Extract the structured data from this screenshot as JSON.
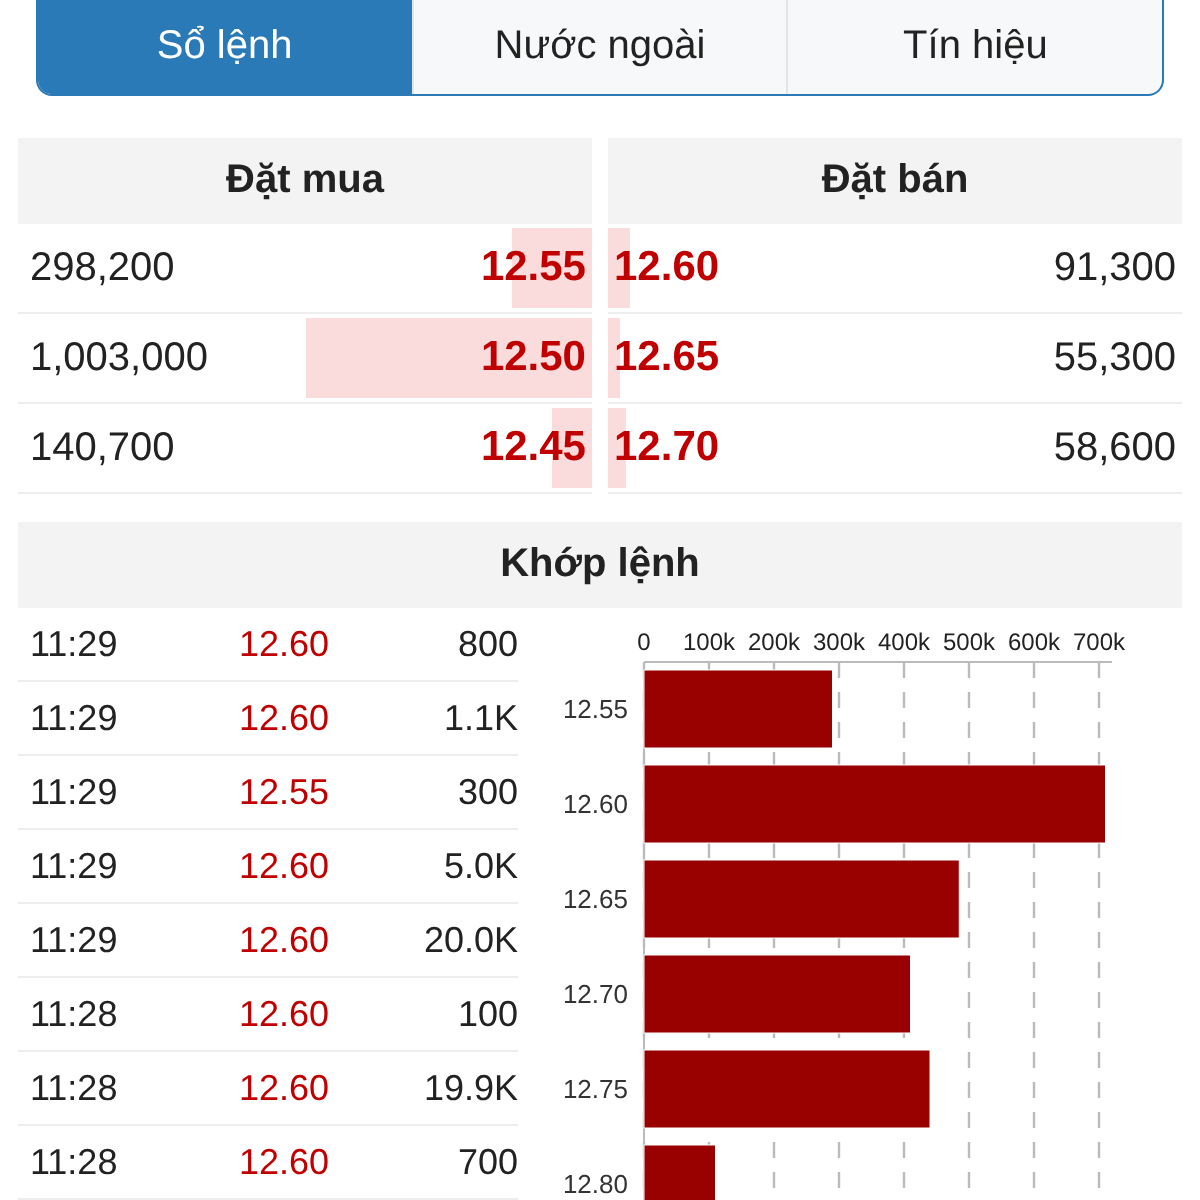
{
  "tabs": [
    {
      "label": "Sổ lệnh",
      "selected": true
    },
    {
      "label": "Nước ngoài",
      "selected": false
    },
    {
      "label": "Tín hiệu",
      "selected": false
    }
  ],
  "order_book": {
    "bid_header": "Đặt mua",
    "ask_header": "Đặt bán",
    "rows": [
      {
        "bid": {
          "volume": "298,200",
          "price": "12.55",
          "level": 0.14
        },
        "ask": {
          "price": "12.60",
          "level": 0.04,
          "volume": "91,300"
        }
      },
      {
        "bid": {
          "volume": "1,003,000",
          "price": "12.50",
          "level": 0.5
        },
        "ask": {
          "price": "12.65",
          "level": 0.02,
          "volume": "55,300"
        }
      },
      {
        "bid": {
          "volume": "140,700",
          "price": "12.45",
          "level": 0.07
        },
        "ask": {
          "price": "12.70",
          "level": 0.03,
          "volume": "58,600"
        }
      }
    ]
  },
  "matches": {
    "title": "Khớp lệnh",
    "rows": [
      {
        "time": "11:29",
        "price": "12.60",
        "volume": "800"
      },
      {
        "time": "11:29",
        "price": "12.60",
        "volume": "1.1K"
      },
      {
        "time": "11:29",
        "price": "12.55",
        "volume": "300"
      },
      {
        "time": "11:29",
        "price": "12.60",
        "volume": "5.0K"
      },
      {
        "time": "11:29",
        "price": "12.60",
        "volume": "20.0K"
      },
      {
        "time": "11:28",
        "price": "12.60",
        "volume": "100"
      },
      {
        "time": "11:28",
        "price": "12.60",
        "volume": "19.9K"
      },
      {
        "time": "11:28",
        "price": "12.60",
        "volume": "700"
      }
    ],
    "chart_data": {
      "type": "bar",
      "orientation": "horizontal",
      "grid": true,
      "categories": [
        "12.55",
        "12.60",
        "12.65",
        "12.70",
        "12.75",
        "12.80"
      ],
      "series": [
        {
          "color": "#990000",
          "values": [
            290000,
            710000,
            485000,
            410000,
            440000,
            110000
          ]
        }
      ],
      "xlim": [
        0,
        720000
      ],
      "xticks": [
        {
          "value": 0,
          "label": "0"
        },
        {
          "value": 100000,
          "label": "100k"
        },
        {
          "value": 200000,
          "label": "200k"
        },
        {
          "value": 300000,
          "label": "300k"
        },
        {
          "value": 400000,
          "label": "400k"
        },
        {
          "value": 500000,
          "label": "500k"
        },
        {
          "value": 600000,
          "label": "600k"
        },
        {
          "value": 700000,
          "label": "700k"
        }
      ]
    }
  }
}
